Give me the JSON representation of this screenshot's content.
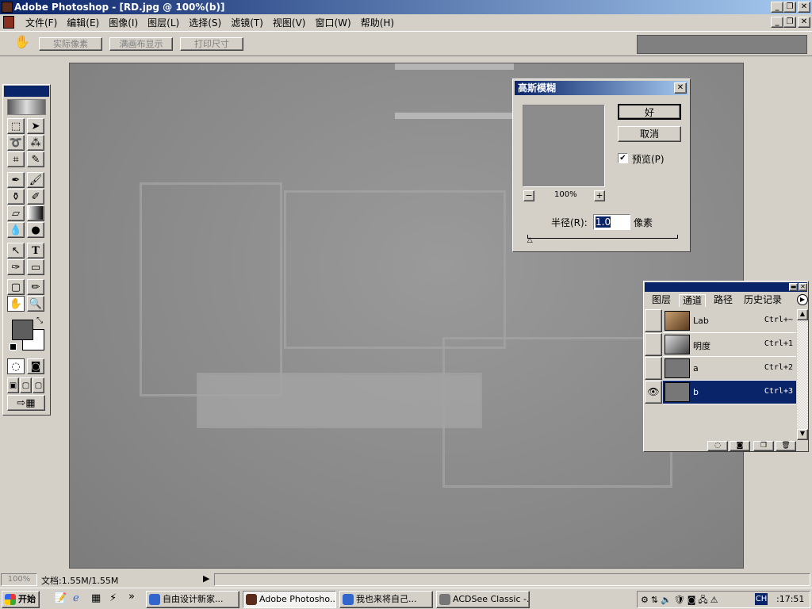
{
  "app": {
    "title": "Adobe Photoshop - [RD.jpg @ 100%(b)]"
  },
  "menu": [
    "文件(F)",
    "编辑(E)",
    "图像(I)",
    "图层(L)",
    "选择(S)",
    "滤镜(T)",
    "视图(V)",
    "窗口(W)",
    "帮助(H)"
  ],
  "options": {
    "actual_pixels": "实际像素",
    "fit_screen": "满画布显示",
    "print_size": "打印尺寸"
  },
  "toolbox": {
    "tools": [
      "rectangular-marquee",
      "move",
      "lasso",
      "magic-wand",
      "crop",
      "slice",
      "airbrush",
      "paintbrush",
      "clone-stamp",
      "history-brush",
      "eraser",
      "gradient",
      "blur",
      "dodge",
      "path-selection",
      "type",
      "pen",
      "rectangle",
      "notes",
      "eyedropper",
      "hand",
      "zoom"
    ],
    "foreground_color": "#5e5e5e",
    "background_color": "#ffffff"
  },
  "dialog": {
    "title": "高斯模糊",
    "ok": "好",
    "cancel": "取消",
    "preview_label": "预览(P)",
    "preview_checked": true,
    "zoom": "100%",
    "radius_label": "半径(R):",
    "radius_value": "1.0",
    "unit": "像素",
    "slider_fraction": 0.02
  },
  "channels_panel": {
    "tabs": [
      "图层",
      "通道",
      "路径",
      "历史记录"
    ],
    "active_tab": "通道",
    "channels": [
      {
        "name": "Lab",
        "shortcut": "Ctrl+~",
        "visible": false,
        "selected": false
      },
      {
        "name": "明度",
        "shortcut": "Ctrl+1",
        "visible": false,
        "selected": false
      },
      {
        "name": "a",
        "shortcut": "Ctrl+2",
        "visible": false,
        "selected": false
      },
      {
        "name": "b",
        "shortcut": "Ctrl+3",
        "visible": true,
        "selected": true
      }
    ]
  },
  "status": {
    "zoom": "100%",
    "doc": "文档:1.55M/1.55M"
  },
  "taskbar": {
    "start": "开始",
    "tasks": [
      "自由设计新家...",
      "Adobe Photosho...",
      "我也来将自己...",
      "ACDSee Classic -..."
    ],
    "active_task": 1,
    "tray_lang": "CH",
    "clock": ":17:51"
  }
}
